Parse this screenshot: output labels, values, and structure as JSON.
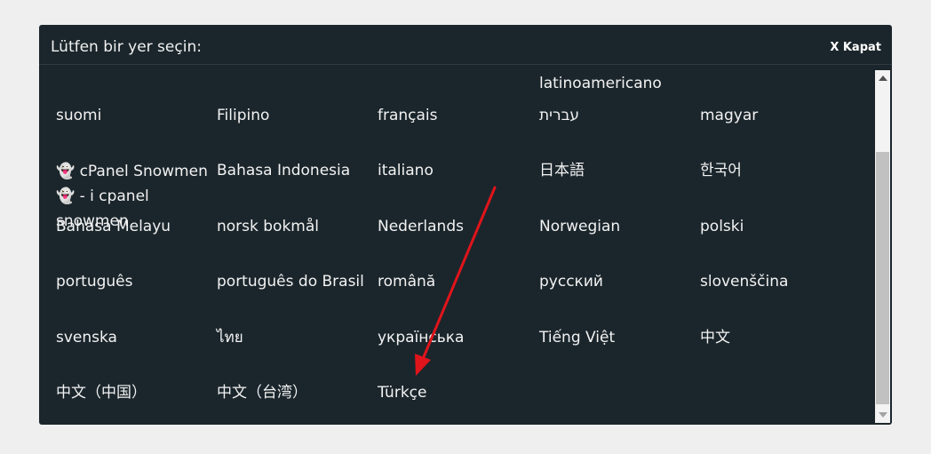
{
  "dialog": {
    "title": "Lütfen bir yer seçin:",
    "close_label": "X Kapat"
  },
  "languages": [
    "latinoamericano",
    "suomi",
    "Filipino",
    "français",
    "עברית",
    "magyar",
    "👻 cPanel Snowmen 👻 - i cpanel snowmen",
    "Bahasa Indonesia",
    "italiano",
    "日本語",
    "한국어",
    "Bahasa Melayu",
    "norsk bokmål",
    "Nederlands",
    "Norwegian",
    "polski",
    "português",
    "português do Brasil",
    "română",
    "русский",
    "slovenščina",
    "svenska",
    "ไทย",
    "українська",
    "Tiếng Việt",
    "中文",
    "中文（中国）",
    "中文（台湾）",
    "Türkçe"
  ],
  "colors": {
    "dialog_bg": "#1b262c",
    "page_bg": "#efefef",
    "text": "#f2f2f2",
    "annotation_arrow": "#e0141b"
  }
}
